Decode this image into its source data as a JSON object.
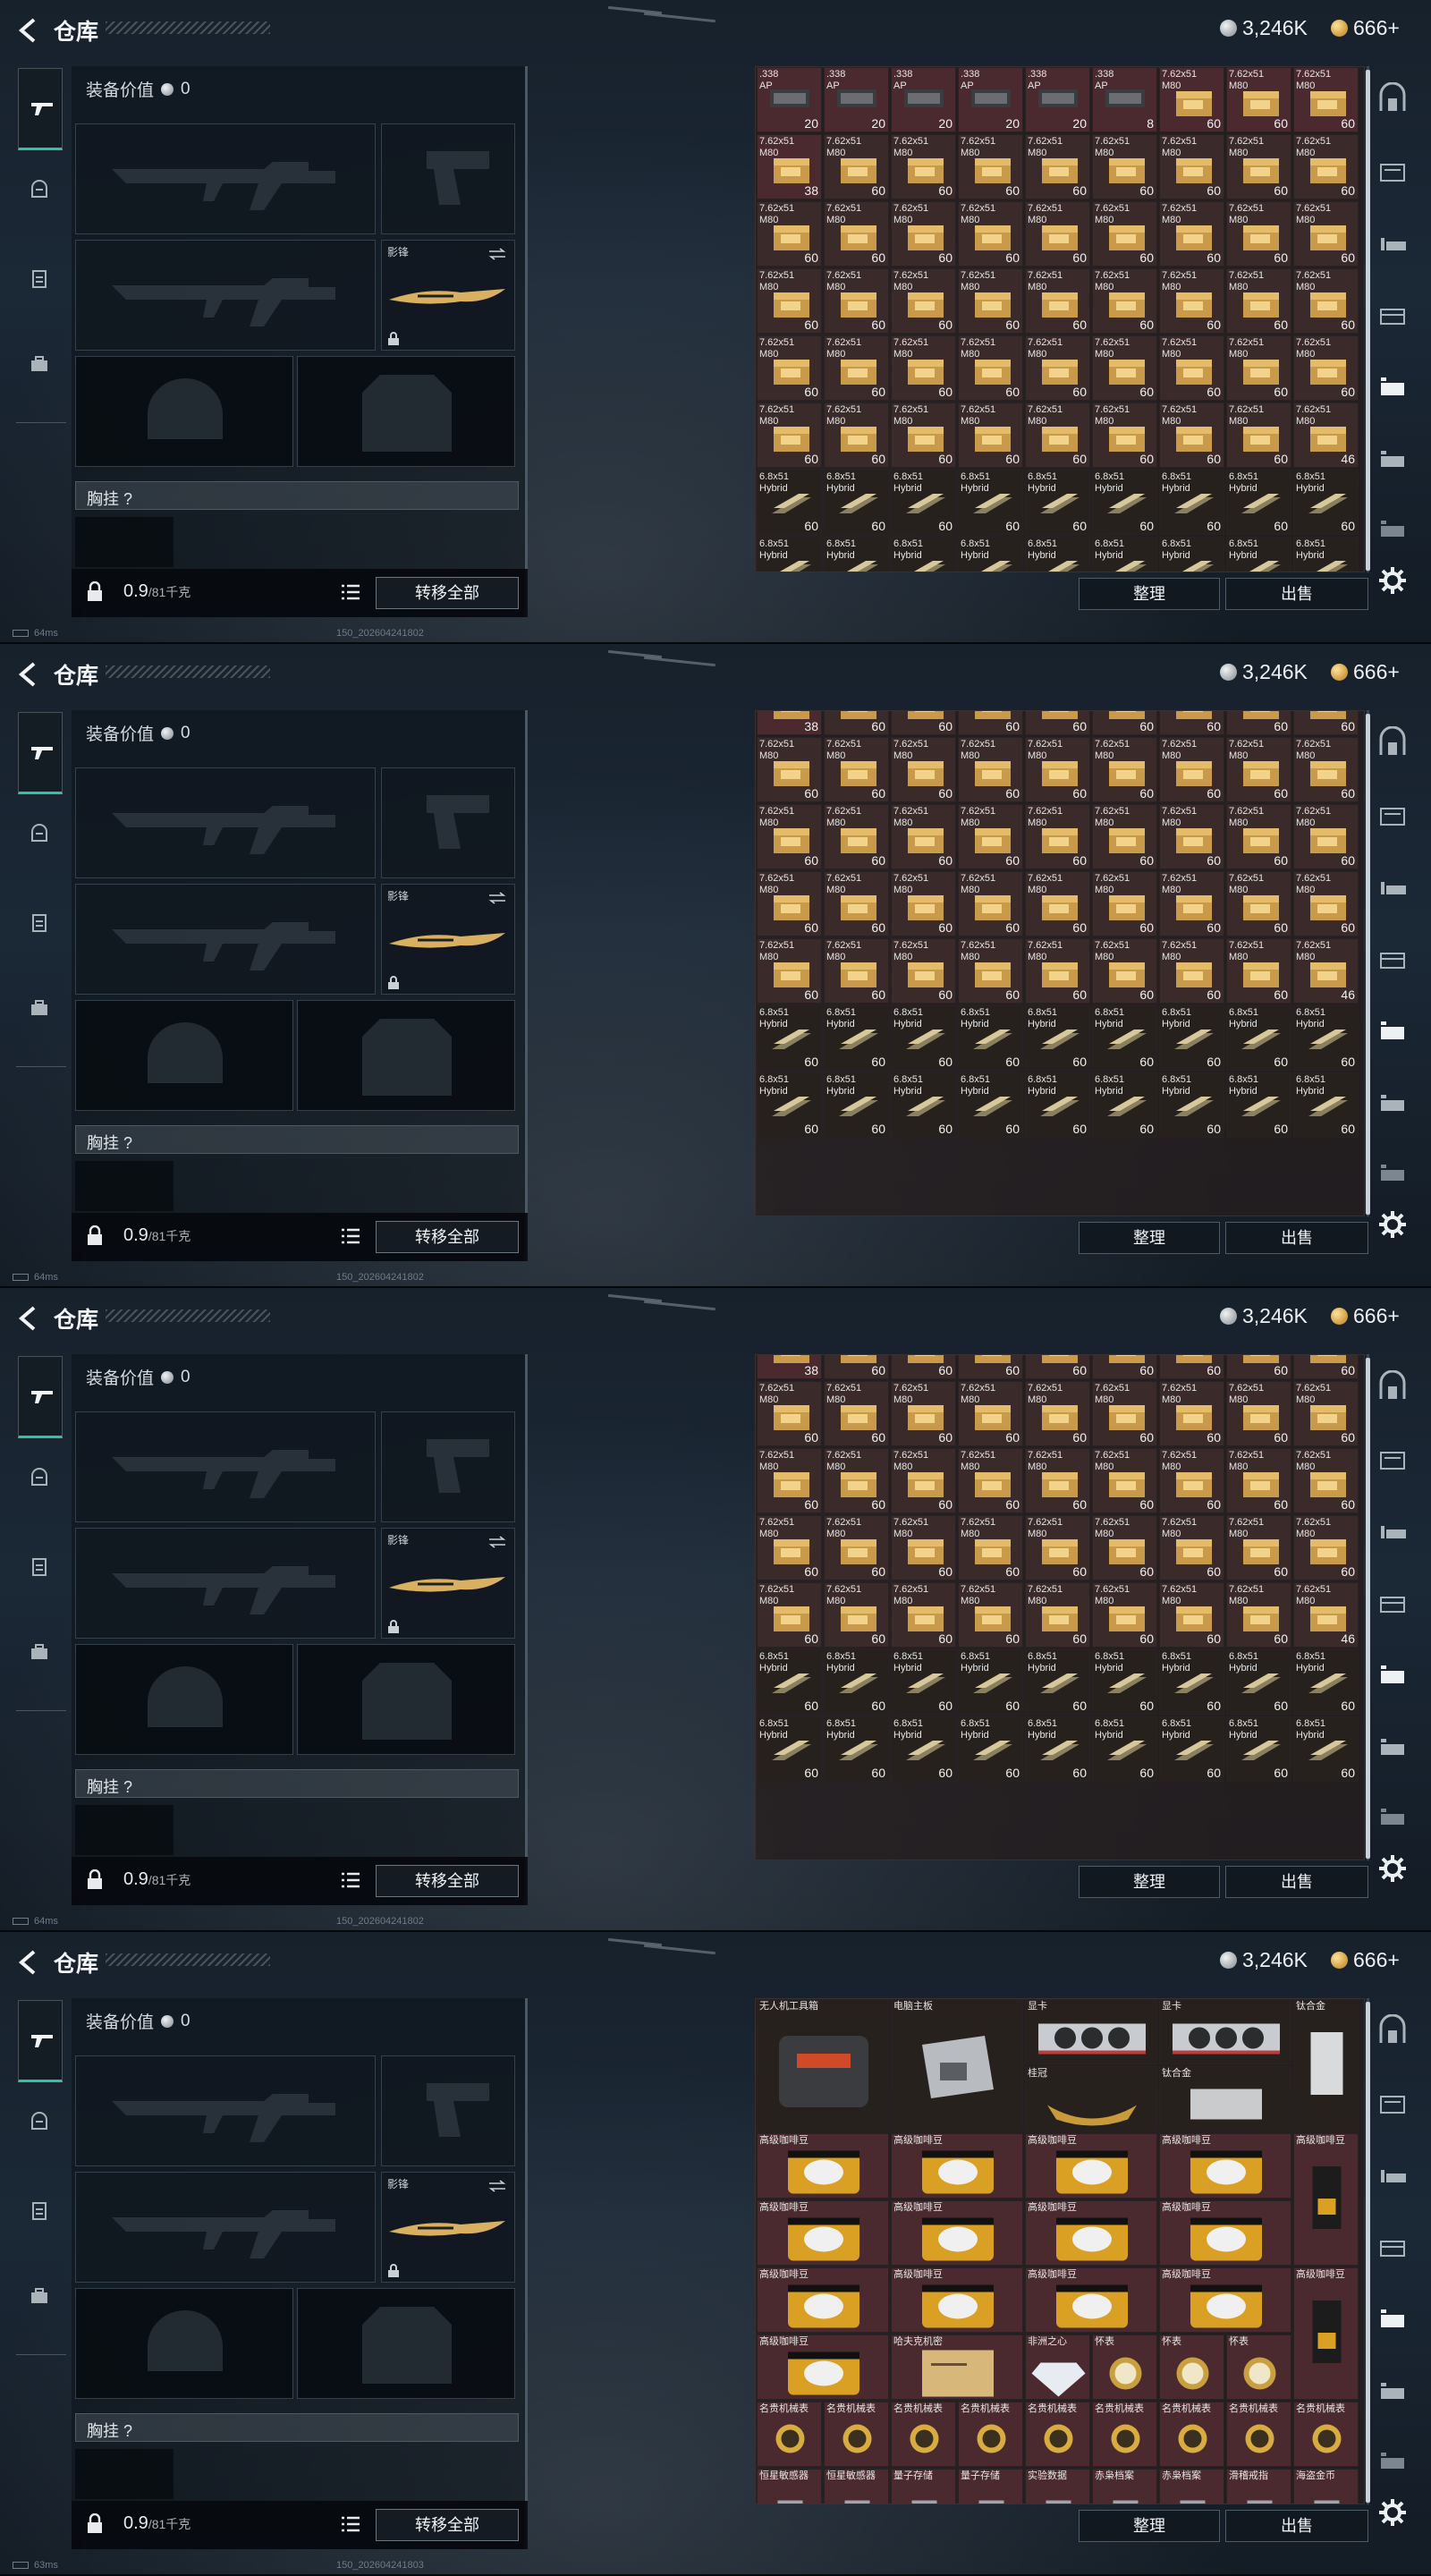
{
  "title": "仓库",
  "currency": {
    "silver": "3,246K",
    "gold": "666+"
  },
  "equip_value_label": "装备价值",
  "equip_value": "0",
  "melee_label": "影锋",
  "vest_label": "胸挂 ?",
  "weight": "0.9",
  "weight_max": "/81千克",
  "transfer_all": "转移全部",
  "sort": "整理",
  "sell": "出售",
  "screens": [
    {
      "ping": "64ms",
      "build": "150_202604241802"
    },
    {
      "ping": "64ms",
      "build": "150_202604241802"
    },
    {
      "ping": "64ms",
      "build": "150_202604241802"
    },
    {
      "ping": "63ms",
      "build": "150_202604241803"
    }
  ],
  "ammo": {
    "ap338": ".338\nAP",
    "ap338_short": ".338",
    "m80": "7.62x51\nM80",
    "hybrid": "6.8x51\nHybrid",
    "ap338_qty": [
      "20",
      "20",
      "20",
      "20",
      "20",
      "8"
    ],
    "row_qty": "60",
    "last_m80_qty": "46",
    "first_m80_qty": "38"
  },
  "valuables": {
    "drone_kit": "无人机工具箱",
    "motherboard": "电脑主板",
    "gpu": "显卡",
    "titanium": "钛合金",
    "crown": "桂冠",
    "coffee": "高级咖啡豆",
    "archive": "哈夫克机密",
    "diamond": "非洲之心",
    "pocket_watch": "怀表",
    "luxury_watch": "名贵机械表",
    "stellar_sensor": "恒星敏感器",
    "ionic": "量子存储",
    "experiment_data": "实验数据",
    "red_archive": "赤枭档案",
    "ring": "滑稽戒指",
    "gold_coin": "海盗金币"
  }
}
